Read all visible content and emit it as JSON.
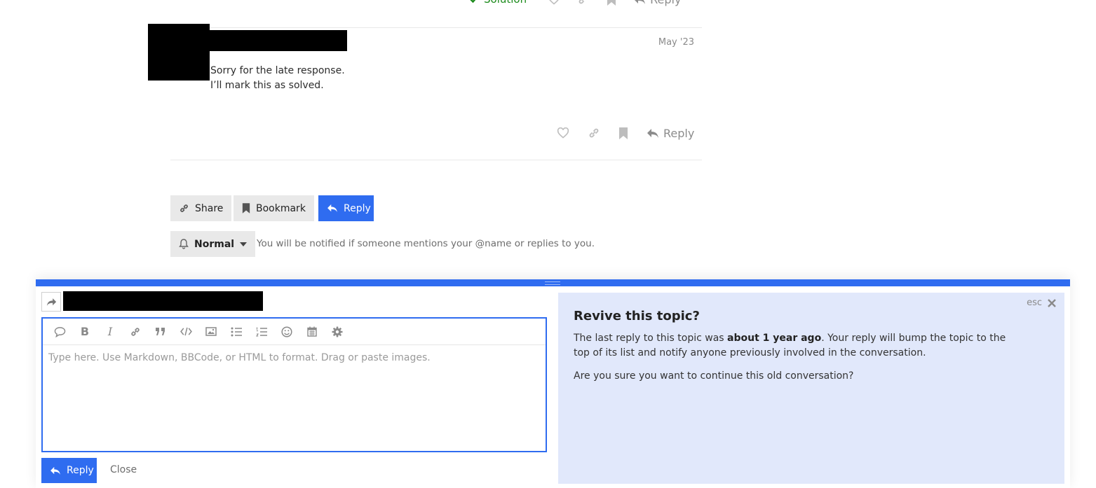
{
  "top_actions": {
    "solution_label": "Solution",
    "reply_label": "Reply"
  },
  "post": {
    "date": "May '23",
    "lines": [
      "Sorry for the late response.",
      "I’ll mark this as solved."
    ],
    "reply_label": "Reply"
  },
  "topic_footer": {
    "share_label": "Share",
    "bookmark_label": "Bookmark",
    "reply_label": "Reply"
  },
  "notifications": {
    "level": "Normal",
    "description": "You will be notified if someone mentions your @name or replies to you."
  },
  "composer": {
    "placeholder": "Type here. Use Markdown, BBCode, or HTML to format. Drag or paste images.",
    "value": "",
    "reply_label": "Reply",
    "close_label": "Close",
    "toolbar_icons": [
      "quote-icon",
      "bold-icon",
      "italic-icon",
      "link-icon",
      "blockquote-icon",
      "code-icon",
      "image-icon",
      "bullet-list-icon",
      "numbered-list-icon",
      "emoji-icon",
      "calendar-icon",
      "gear-icon"
    ],
    "bold_glyph": "B",
    "italic_glyph": "I"
  },
  "revive_notice": {
    "esc_label": "esc",
    "title": "Revive this topic?",
    "body_before": "The last reply to this topic was ",
    "body_bold": "about 1 year ago",
    "body_after": ". Your reply will bump the topic to the top of its list and notify anyone previously involved in the conversation.",
    "question": "Are you sure you want to continue this old conversation?"
  },
  "colors": {
    "accent": "#2f6cf0",
    "solution_green": "#1a8a1a",
    "notice_background": "#e1e8fb",
    "button_grey": "#e9e9e9"
  }
}
